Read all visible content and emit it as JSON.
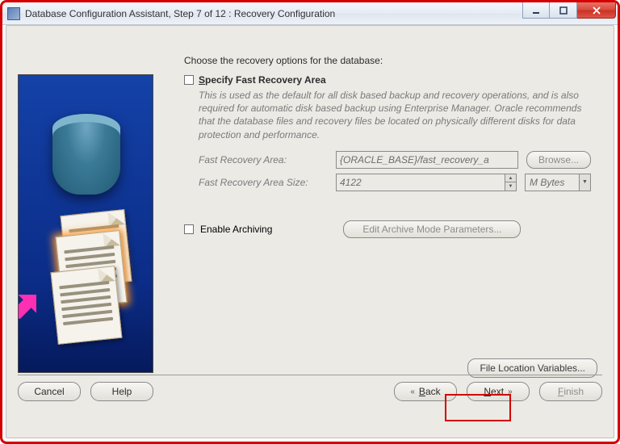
{
  "window": {
    "title": "Database Configuration Assistant, Step 7 of 12 : Recovery Configuration"
  },
  "main": {
    "instruction": "Choose the recovery options for the database:",
    "specify_label": "Specify Fast Recovery Area",
    "description": "This is used as the default for all disk based backup and recovery operations, and is also required for automatic disk based backup using Enterprise Manager. Oracle recommends that the database files and recovery files be located on physically different disks for data protection and performance.",
    "fra_label": "Fast Recovery Area:",
    "fra_value": "{ORACLE_BASE}/fast_recovery_a",
    "browse_label": "Browse...",
    "fra_size_label": "Fast Recovery Area Size:",
    "fra_size_value": "4122",
    "fra_size_unit": "M Bytes",
    "archiving_label": "Enable Archiving",
    "archive_params_label": "Edit Archive Mode Parameters..."
  },
  "footer": {
    "file_loc_label": "File Location Variables...",
    "cancel": "Cancel",
    "help": "Help",
    "back": "Back",
    "next": "Next",
    "finish": "Finish"
  }
}
